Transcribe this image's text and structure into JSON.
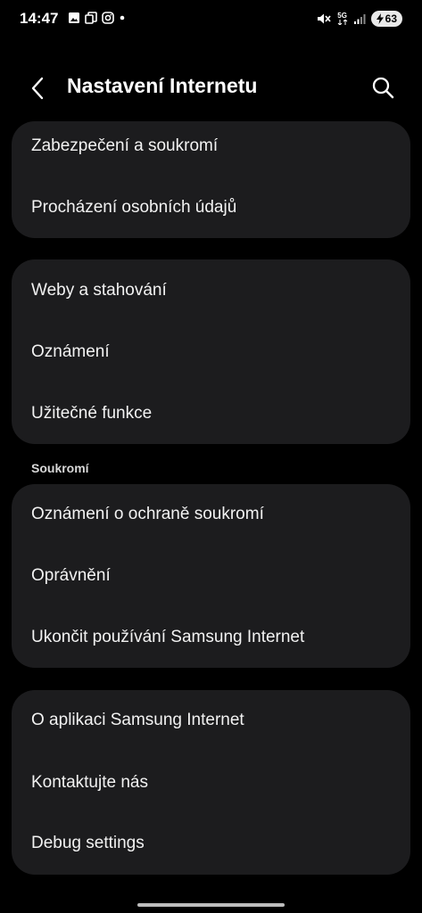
{
  "status_bar": {
    "time": "14:47",
    "network": "5G",
    "battery": "63"
  },
  "header": {
    "title": "Nastavení Internetu"
  },
  "groups": [
    {
      "items": [
        "Zabezpečení a soukromí",
        "Procházení osobních údajů"
      ]
    },
    {
      "items": [
        "Weby a stahování",
        "Oznámení",
        "Užitečné funkce"
      ]
    },
    {
      "section": "Soukromí",
      "items": [
        "Oznámení o ochraně soukromí",
        "Oprávnění",
        "Ukončit používání Samsung Internet"
      ]
    },
    {
      "items": [
        "O aplikaci Samsung Internet",
        "Kontaktujte nás",
        "Debug settings"
      ]
    }
  ]
}
